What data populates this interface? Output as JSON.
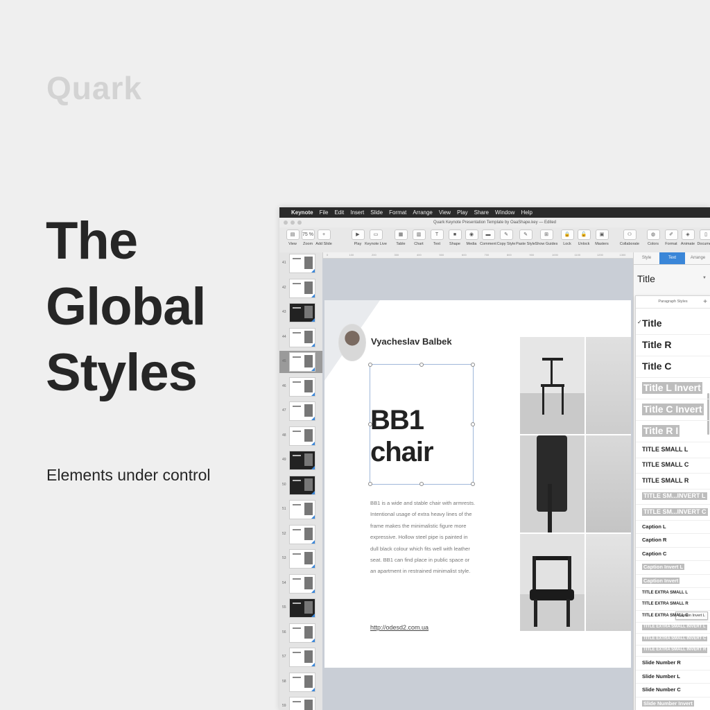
{
  "marketing": {
    "brand": "Quark",
    "headline": [
      "The",
      "Global",
      "Styles"
    ],
    "tagline": "Elements under control"
  },
  "menubar": {
    "app": "Keynote",
    "items": [
      "File",
      "Edit",
      "Insert",
      "Slide",
      "Format",
      "Arrange",
      "View",
      "Play",
      "Share",
      "Window",
      "Help"
    ]
  },
  "window": {
    "title": "Quark Keynote Presentation Template by OaaShape.key — Edited"
  },
  "toolbar": {
    "buttons": [
      {
        "label": "View",
        "icon": "▤"
      },
      {
        "label": "Zoom",
        "icon": "75 %"
      },
      {
        "label": "Add Slide",
        "icon": "+"
      },
      {
        "label": "Play",
        "icon": "▶"
      },
      {
        "label": "Keynote Live",
        "icon": "▭"
      },
      {
        "label": "Table",
        "icon": "▦"
      },
      {
        "label": "Chart",
        "icon": "▥"
      },
      {
        "label": "Text",
        "icon": "T"
      },
      {
        "label": "Shape",
        "icon": "■"
      },
      {
        "label": "Media",
        "icon": "◉"
      },
      {
        "label": "Comment",
        "icon": "▬"
      },
      {
        "label": "Copy Style",
        "icon": "✎"
      },
      {
        "label": "Paste Style",
        "icon": "✎"
      },
      {
        "label": "Show Guides",
        "icon": "⊞"
      },
      {
        "label": "Lock",
        "icon": "🔒"
      },
      {
        "label": "Unlock",
        "icon": "🔓"
      },
      {
        "label": "Masters",
        "icon": "▣"
      },
      {
        "label": "Collaborate",
        "icon": "⚇"
      },
      {
        "label": "Colors",
        "icon": "◍"
      },
      {
        "label": "Format",
        "icon": "✐"
      },
      {
        "label": "Animate",
        "icon": "◈"
      },
      {
        "label": "Document",
        "icon": "▯"
      }
    ]
  },
  "ruler": {
    "ticks": [
      "0",
      "100",
      "200",
      "300",
      "400",
      "500",
      "600",
      "700",
      "800",
      "900",
      "1000",
      "1100",
      "1200",
      "1300"
    ]
  },
  "navigator": {
    "slides": [
      {
        "number": "41",
        "dark": false
      },
      {
        "number": "42",
        "dark": false
      },
      {
        "number": "43",
        "dark": true
      },
      {
        "number": "44",
        "dark": false
      },
      {
        "number": "45",
        "dark": false
      },
      {
        "number": "46",
        "dark": false
      },
      {
        "number": "47",
        "dark": false
      },
      {
        "number": "48",
        "dark": false
      },
      {
        "number": "49",
        "dark": true
      },
      {
        "number": "50",
        "dark": true
      },
      {
        "number": "51",
        "dark": false
      },
      {
        "number": "52",
        "dark": false
      },
      {
        "number": "53",
        "dark": false
      },
      {
        "number": "54",
        "dark": false
      },
      {
        "number": "55",
        "dark": true
      },
      {
        "number": "56",
        "dark": false
      },
      {
        "number": "57",
        "dark": false
      },
      {
        "number": "58",
        "dark": false
      },
      {
        "number": "59",
        "dark": false
      }
    ],
    "selected_index": 4
  },
  "slide": {
    "author": "Vyacheslav Balbek",
    "title_lines": [
      "BB1",
      "chair"
    ],
    "body": "BB1 is a wide and stable chair with armrests. Intentional usage of extra heavy lines of the frame makes the minimalistic figure more expressive. Hollow steel pipe is painted in dull black colour which fits well with leather seat. BB1 can find place in public space or an apartment in restrained minimalist style.",
    "link": "http://odesd2.com.ua"
  },
  "inspector": {
    "tabs": [
      "Style",
      "Text",
      "Arrange"
    ],
    "active_tab": "Text",
    "current_style": "Title",
    "paragraph_styles_header": "Paragraph Styles",
    "checkmark": "✓",
    "styles": [
      {
        "name": "Title",
        "invert": false,
        "size": 14,
        "checked": true
      },
      {
        "name": "Title R",
        "invert": false,
        "size": 14
      },
      {
        "name": "Title C",
        "invert": false,
        "size": 14
      },
      {
        "name": "Title L Invert",
        "invert": true,
        "size": 14
      },
      {
        "name": "Title C Invert",
        "invert": true,
        "size": 14
      },
      {
        "name": "Title R I",
        "invert": true,
        "size": 14
      },
      {
        "name": "TITLE SMALL L",
        "invert": false,
        "size": 9
      },
      {
        "name": "TITLE SMALL C",
        "invert": false,
        "size": 9
      },
      {
        "name": "TITLE SMALL R",
        "invert": false,
        "size": 9
      },
      {
        "name": "TITLE SM...INVERT L",
        "invert": true,
        "size": 9
      },
      {
        "name": "TITLE SM...INVERT C",
        "invert": true,
        "size": 9
      },
      {
        "name": "Caption L",
        "invert": false,
        "size": 7.5
      },
      {
        "name": "Caption R",
        "invert": false,
        "size": 7.5
      },
      {
        "name": "Caption C",
        "invert": false,
        "size": 7.5
      },
      {
        "name": "Caption Invert L",
        "invert": true,
        "size": 7.5
      },
      {
        "name": "Caption Invert",
        "invert": true,
        "size": 7.5
      },
      {
        "name": "TITLE EXTRA SMALL L",
        "invert": false,
        "size": 6
      },
      {
        "name": "TITLE EXTRA SMALL R",
        "invert": false,
        "size": 6
      },
      {
        "name": "TITLE EXTRA SMALL C",
        "invert": false,
        "size": 6
      },
      {
        "name": "TITLE EXTRA SMALL INVERT L",
        "invert": true,
        "size": 6
      },
      {
        "name": "TITLE EXTRA SMALL INVERT C",
        "invert": true,
        "size": 6
      },
      {
        "name": "TITLE EXTRA SMALL INVERT R",
        "invert": true,
        "size": 6
      },
      {
        "name": "Slide Number R",
        "invert": false,
        "size": 7.5
      },
      {
        "name": "Slide Number L",
        "invert": false,
        "size": 7.5
      },
      {
        "name": "Slide Number C",
        "invert": false,
        "size": 7.5
      },
      {
        "name": "Slide Number Invert",
        "invert": true,
        "size": 7.5
      }
    ],
    "tooltip": "Caption Invert L",
    "accent": "#3a86d8"
  }
}
